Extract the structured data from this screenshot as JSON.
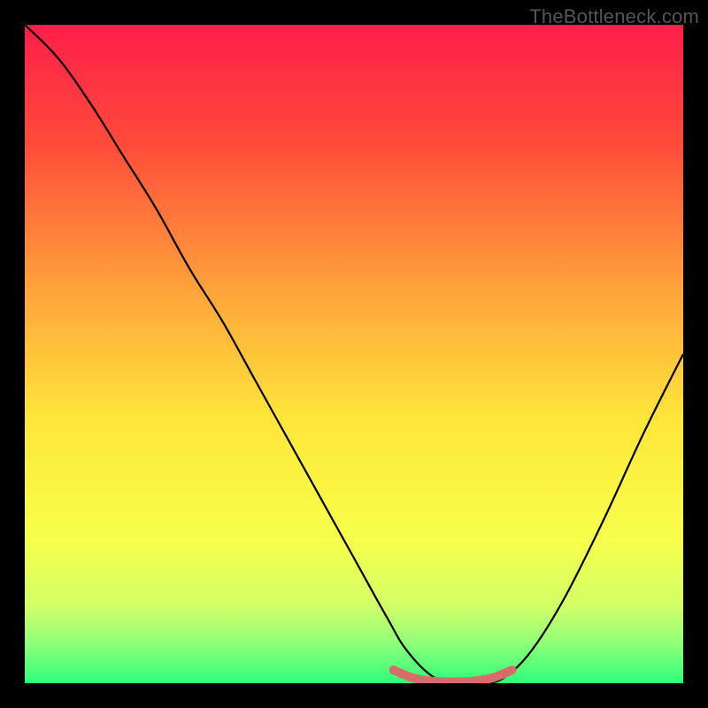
{
  "watermark": "TheBottleneck.com",
  "chart_data": {
    "type": "line",
    "title": "",
    "xlabel": "",
    "ylabel": "",
    "xlim": [
      0,
      100
    ],
    "ylim": [
      0,
      100
    ],
    "gradient_stops": [
      {
        "offset": 0,
        "color": "#ff1e4a"
      },
      {
        "offset": 18,
        "color": "#ff4b3a"
      },
      {
        "offset": 40,
        "color": "#ffa23a"
      },
      {
        "offset": 60,
        "color": "#ffe63a"
      },
      {
        "offset": 78,
        "color": "#f7ff4a"
      },
      {
        "offset": 88,
        "color": "#d4ff66"
      },
      {
        "offset": 94,
        "color": "#8fff7a"
      },
      {
        "offset": 100,
        "color": "#2dff7a"
      }
    ],
    "series": [
      {
        "name": "curve",
        "color": "#000000",
        "x": [
          0,
          5,
          10,
          15,
          20,
          25,
          30,
          35,
          40,
          45,
          50,
          55,
          58,
          62,
          66,
          70,
          73,
          77,
          82,
          88,
          94,
          100
        ],
        "y": [
          100,
          95,
          88,
          80,
          72,
          63,
          55,
          46,
          37,
          28,
          19,
          10,
          5,
          1,
          0,
          0,
          1,
          5,
          13,
          25,
          38,
          50
        ]
      }
    ],
    "marker": {
      "name": "highlight-segment",
      "color": "#d96b6b",
      "x": [
        56,
        59,
        62,
        65,
        68,
        71,
        74
      ],
      "y": [
        2,
        0.8,
        0.3,
        0.2,
        0.3,
        0.8,
        2
      ]
    }
  }
}
